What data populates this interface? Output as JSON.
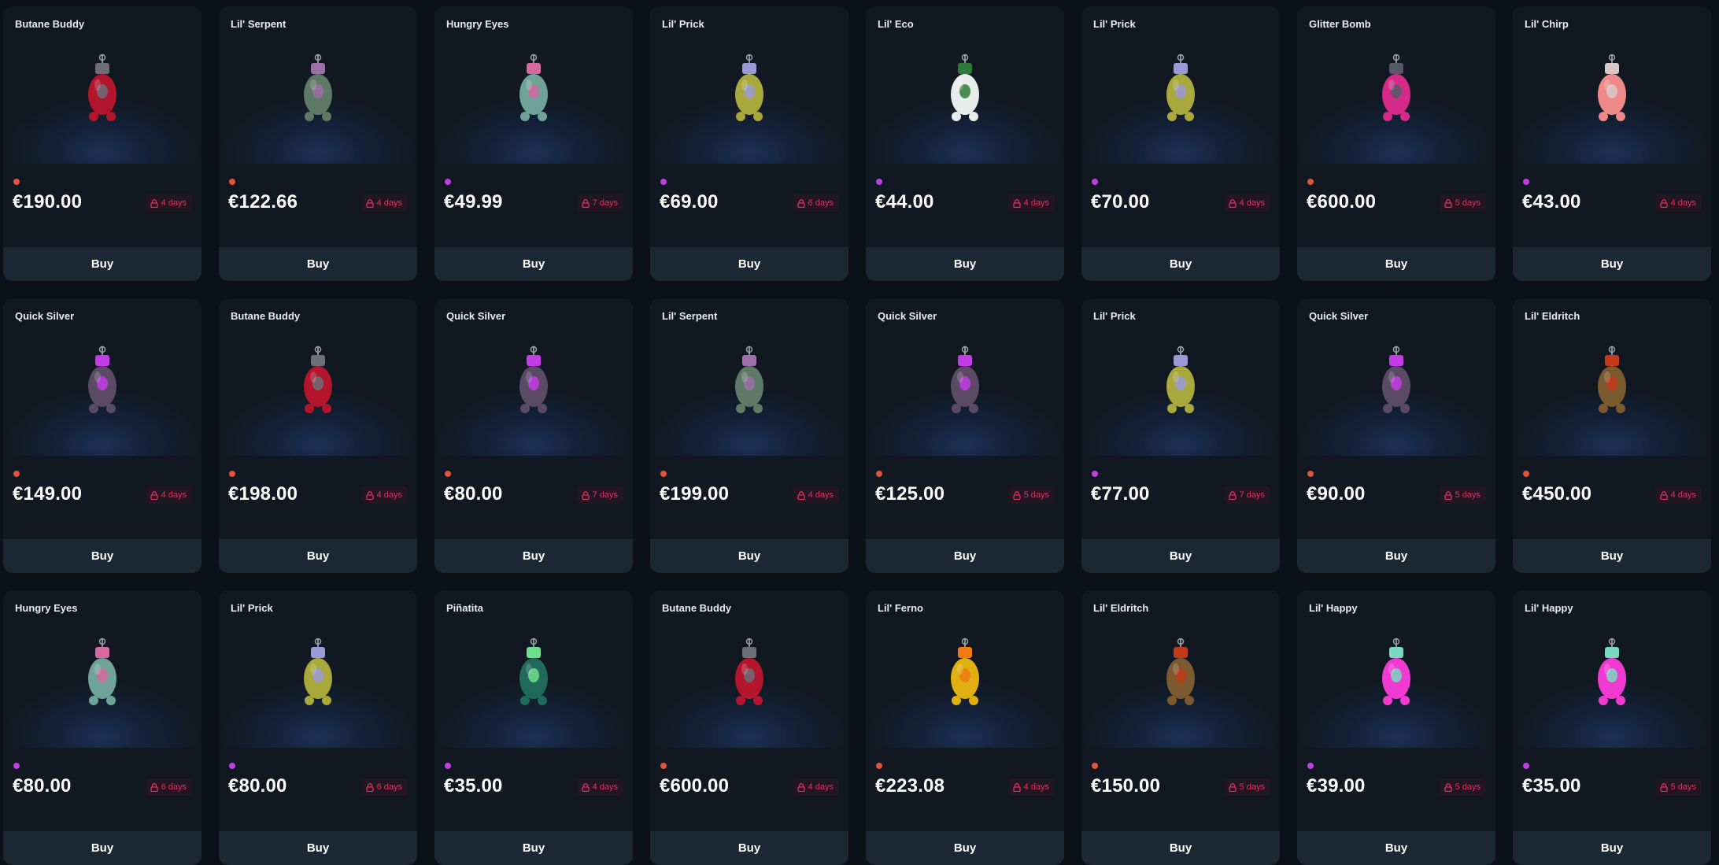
{
  "colors": {
    "page_background": "#0b1019",
    "card_background": "#111821",
    "buy_button_background": "#1c2734",
    "lock_text": "#e0305f",
    "rarity": {
      "orange": "#e25436",
      "purple": "#c23ee0"
    }
  },
  "listings": [
    {
      "name": "Butane Buddy",
      "price": "€190.00",
      "lock": "4 days",
      "rarity": "orange",
      "figure": {
        "body": "#b3162c",
        "accent": "#6d6f78"
      },
      "buy_label": "Buy"
    },
    {
      "name": "Lil' Serpent",
      "price": "€122.66",
      "lock": "4 days",
      "rarity": "orange",
      "figure": {
        "body": "#5e7a66",
        "accent": "#9b6fa8"
      },
      "buy_label": "Buy"
    },
    {
      "name": "Hungry Eyes",
      "price": "€49.99",
      "lock": "7 days",
      "rarity": "purple",
      "figure": {
        "body": "#6fa39a",
        "accent": "#d46aa0"
      },
      "buy_label": "Buy"
    },
    {
      "name": "Lil' Prick",
      "price": "€69.00",
      "lock": "6 days",
      "rarity": "purple",
      "figure": {
        "body": "#a8a83c",
        "accent": "#9a9ad8"
      },
      "buy_label": "Buy"
    },
    {
      "name": "Lil' Eco",
      "price": "€44.00",
      "lock": "4 days",
      "rarity": "purple",
      "figure": {
        "body": "#e8ecea",
        "accent": "#2f7a3a"
      },
      "buy_label": "Buy"
    },
    {
      "name": "Lil' Prick",
      "price": "€70.00",
      "lock": "4 days",
      "rarity": "purple",
      "figure": {
        "body": "#a8a83c",
        "accent": "#9a9ad8"
      },
      "buy_label": "Buy"
    },
    {
      "name": "Glitter Bomb",
      "price": "€600.00",
      "lock": "5 days",
      "rarity": "orange",
      "figure": {
        "body": "#d62a8a",
        "accent": "#555a66"
      },
      "buy_label": "Buy"
    },
    {
      "name": "Lil' Chirp",
      "price": "€43.00",
      "lock": "4 days",
      "rarity": "purple",
      "figure": {
        "body": "#f08a8a",
        "accent": "#d8c8c8"
      },
      "buy_label": "Buy"
    },
    {
      "name": "Quick Silver",
      "price": "€149.00",
      "lock": "4 days",
      "rarity": "orange",
      "figure": {
        "body": "#5a4a63",
        "accent": "#c43ce6"
      },
      "buy_label": "Buy"
    },
    {
      "name": "Butane Buddy",
      "price": "€198.00",
      "lock": "4 days",
      "rarity": "orange",
      "figure": {
        "body": "#b3162c",
        "accent": "#6d6f78"
      },
      "buy_label": "Buy"
    },
    {
      "name": "Quick Silver",
      "price": "€80.00",
      "lock": "7 days",
      "rarity": "orange",
      "figure": {
        "body": "#5a4a63",
        "accent": "#c43ce6"
      },
      "buy_label": "Buy"
    },
    {
      "name": "Lil' Serpent",
      "price": "€199.00",
      "lock": "4 days",
      "rarity": "orange",
      "figure": {
        "body": "#5e7a66",
        "accent": "#9b6fa8"
      },
      "buy_label": "Buy"
    },
    {
      "name": "Quick Silver",
      "price": "€125.00",
      "lock": "5 days",
      "rarity": "orange",
      "figure": {
        "body": "#5a4a63",
        "accent": "#c43ce6"
      },
      "buy_label": "Buy"
    },
    {
      "name": "Lil' Prick",
      "price": "€77.00",
      "lock": "7 days",
      "rarity": "purple",
      "figure": {
        "body": "#a8a83c",
        "accent": "#9a9ad8"
      },
      "buy_label": "Buy"
    },
    {
      "name": "Quick Silver",
      "price": "€90.00",
      "lock": "5 days",
      "rarity": "orange",
      "figure": {
        "body": "#5a4a63",
        "accent": "#c43ce6"
      },
      "buy_label": "Buy"
    },
    {
      "name": "Lil' Eldritch",
      "price": "€450.00",
      "lock": "4 days",
      "rarity": "orange",
      "figure": {
        "body": "#7a5a2e",
        "accent": "#c23a1a"
      },
      "buy_label": "Buy"
    },
    {
      "name": "Hungry Eyes",
      "price": "€80.00",
      "lock": "6 days",
      "rarity": "purple",
      "figure": {
        "body": "#6fa39a",
        "accent": "#d46aa0"
      },
      "buy_label": "Buy"
    },
    {
      "name": "Lil' Prick",
      "price": "€80.00",
      "lock": "6 days",
      "rarity": "purple",
      "figure": {
        "body": "#a8a83c",
        "accent": "#9a9ad8"
      },
      "buy_label": "Buy"
    },
    {
      "name": "Piñatita",
      "price": "€35.00",
      "lock": "4 days",
      "rarity": "purple",
      "figure": {
        "body": "#1f6a5a",
        "accent": "#6ee08c"
      },
      "buy_label": "Buy"
    },
    {
      "name": "Butane Buddy",
      "price": "€600.00",
      "lock": "4 days",
      "rarity": "orange",
      "figure": {
        "body": "#b3162c",
        "accent": "#6d6f78"
      },
      "buy_label": "Buy"
    },
    {
      "name": "Lil' Ferno",
      "price": "€223.08",
      "lock": "4 days",
      "rarity": "orange",
      "figure": {
        "body": "#e0b010",
        "accent": "#f07a10"
      },
      "buy_label": "Buy"
    },
    {
      "name": "Lil' Eldritch",
      "price": "€150.00",
      "lock": "5 days",
      "rarity": "orange",
      "figure": {
        "body": "#7a5a2e",
        "accent": "#c23a1a"
      },
      "buy_label": "Buy"
    },
    {
      "name": "Lil' Happy",
      "price": "€39.00",
      "lock": "5 days",
      "rarity": "purple",
      "figure": {
        "body": "#f03ad2",
        "accent": "#7ad8c0"
      },
      "buy_label": "Buy"
    },
    {
      "name": "Lil' Happy",
      "price": "€35.00",
      "lock": "5 days",
      "rarity": "purple",
      "figure": {
        "body": "#f03ad2",
        "accent": "#7ad8c0"
      },
      "buy_label": "Buy"
    }
  ]
}
